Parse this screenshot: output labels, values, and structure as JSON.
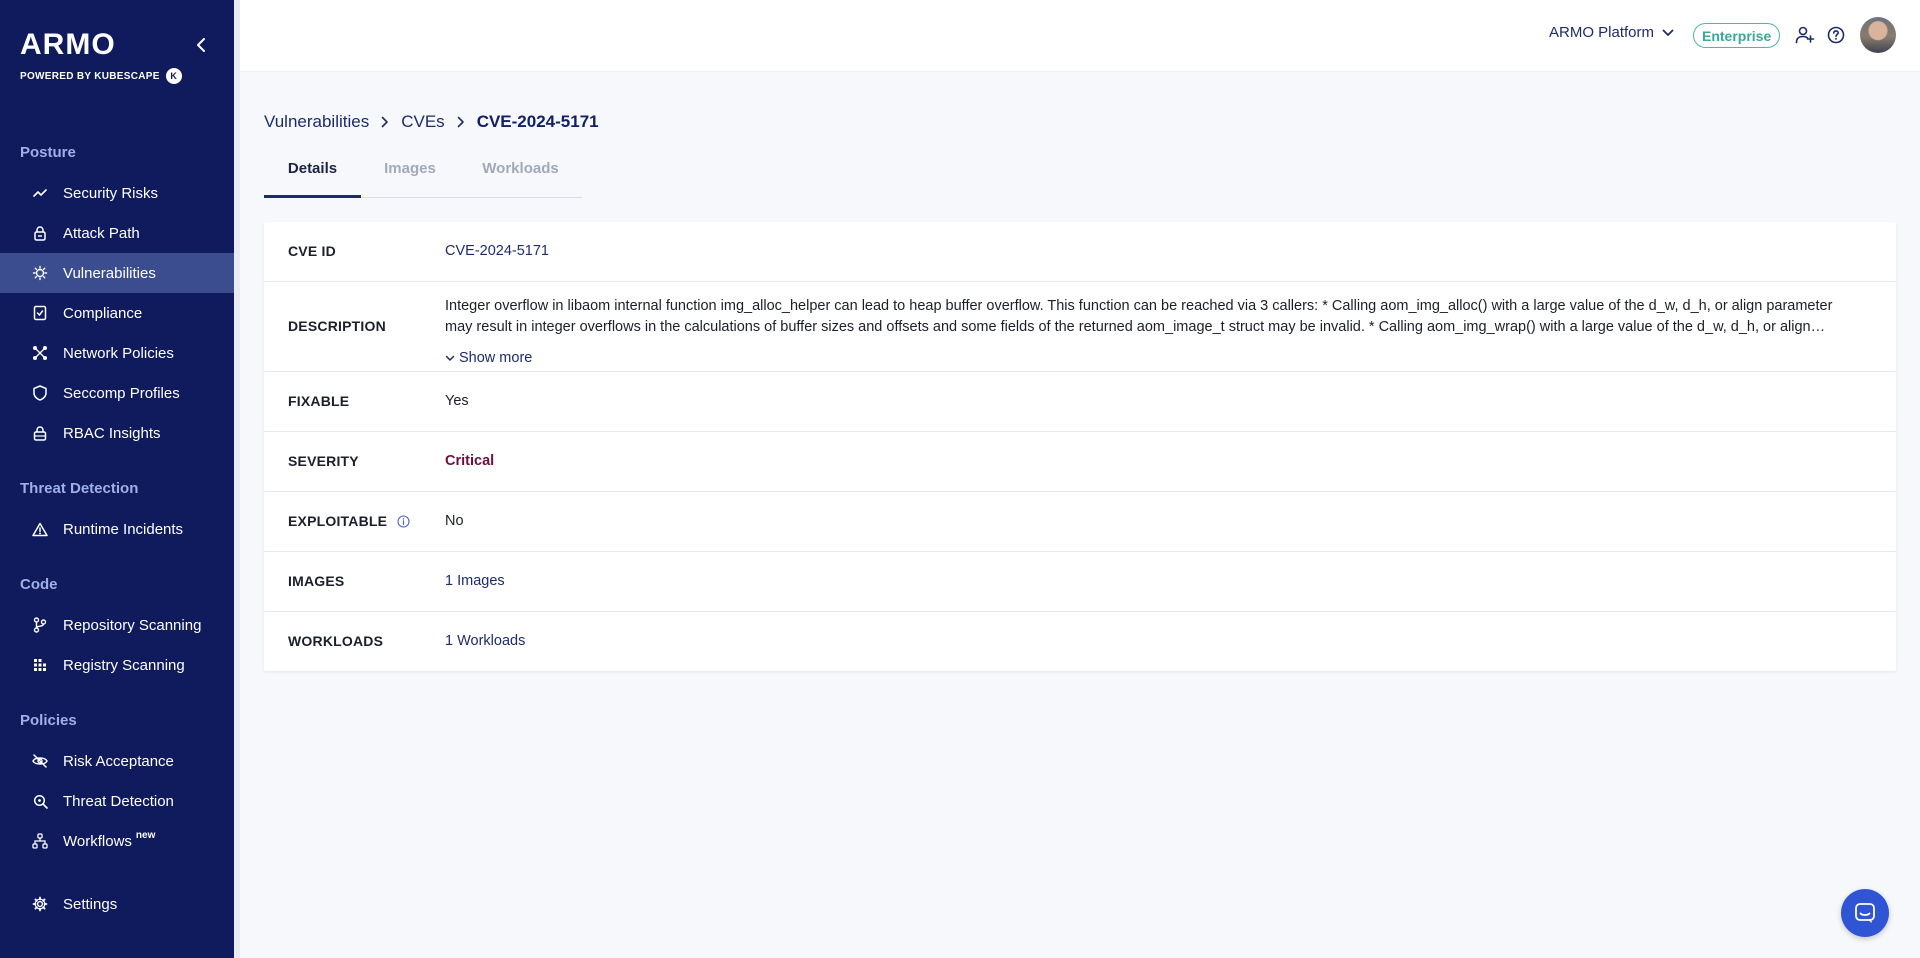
{
  "brand": {
    "name": "ARMO",
    "powered_by": "POWERED BY KUBESCAPE",
    "badge": "K"
  },
  "sidebar": {
    "sections": [
      {
        "title": "Posture",
        "items": [
          {
            "label": "Security Risks",
            "icon": "trend-icon"
          },
          {
            "label": "Attack Path",
            "icon": "lock-path-icon"
          },
          {
            "label": "Vulnerabilities",
            "icon": "bug-icon",
            "active": true
          },
          {
            "label": "Compliance",
            "icon": "compliance-doc-icon"
          },
          {
            "label": "Network Policies",
            "icon": "network-icon"
          },
          {
            "label": "Seccomp Profiles",
            "icon": "shield-icon"
          },
          {
            "label": "RBAC Insights",
            "icon": "lock-icon"
          }
        ]
      },
      {
        "title": "Threat Detection",
        "items": [
          {
            "label": "Runtime Incidents",
            "icon": "warning-icon"
          }
        ]
      },
      {
        "title": "Code",
        "items": [
          {
            "label": "Repository Scanning",
            "icon": "git-branch-icon"
          },
          {
            "label": "Registry Scanning",
            "icon": "registry-icon"
          }
        ]
      },
      {
        "title": "Policies",
        "items": [
          {
            "label": "Risk Acceptance",
            "icon": "eye-off-icon"
          },
          {
            "label": "Threat Detection",
            "icon": "search-icon"
          },
          {
            "label": "Workflows",
            "icon": "workflow-icon",
            "sup": "new"
          }
        ]
      }
    ],
    "settings_label": "Settings"
  },
  "header": {
    "org": "ARMO Platform",
    "plan": "Enterprise"
  },
  "breadcrumb": [
    "Vulnerabilities",
    "CVEs",
    "CVE-2024-5171"
  ],
  "tabs": [
    "Details",
    "Images",
    "Workloads"
  ],
  "details": {
    "cve_id_label": "CVE ID",
    "cve_id": "CVE-2024-5171",
    "description_label": "DESCRIPTION",
    "description": "Integer overflow in libaom internal function img_alloc_helper can lead to heap buffer overflow. This function can be reached via 3 callers: * Calling aom_img_alloc() with a large value of the d_w, d_h, or align parameter may result in integer overflows in the calculations of buffer sizes and offsets and some fields of the returned aom_image_t struct may be invalid. * Calling aom_img_wrap() with a large value of the d_w, d_h, or align…",
    "show_more": "Show more",
    "fixable_label": "FIXABLE",
    "fixable": "Yes",
    "severity_label": "SEVERITY",
    "severity": "Critical",
    "exploitable_label": "EXPLOITABLE",
    "exploitable": "No",
    "images_label": "IMAGES",
    "images": "1 Images",
    "workloads_label": "WORKLOADS",
    "workloads": "1 Workloads"
  },
  "colors": {
    "sidebar_bg": "#0f1b5c",
    "sidebar_active": "#3b4d8f",
    "link": "#1e2b6b",
    "critical": "#6d0f3a",
    "enterprise": "#3aa89a",
    "chat": "#2f55d4"
  }
}
